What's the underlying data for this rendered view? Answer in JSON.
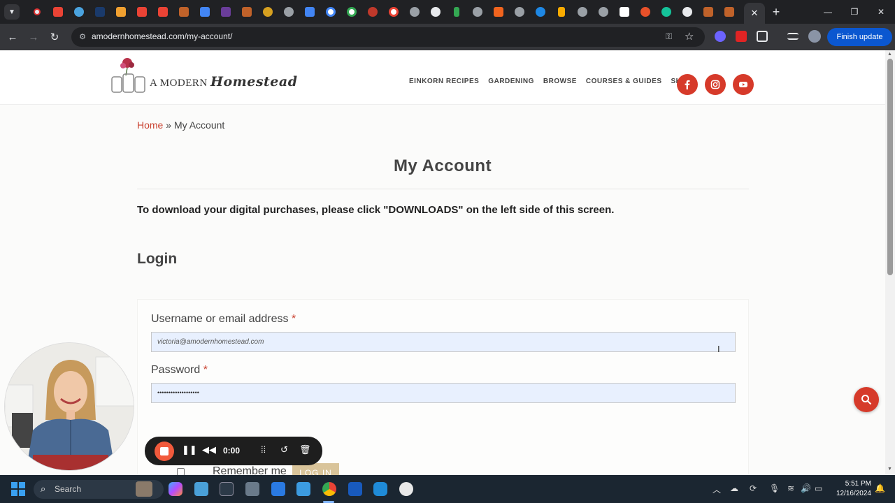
{
  "browser": {
    "url": "amodernhomestead.com/my-account/",
    "finish_update_label": "Finish update",
    "tab_close_glyph": "✕",
    "new_tab_glyph": "+"
  },
  "site": {
    "logo_prefix": "A MODERN",
    "logo_script": "Homestead",
    "nav": [
      "EINKORN RECIPES",
      "GARDENING",
      "BROWSE",
      "COURSES & GUIDES",
      "SHOP"
    ],
    "social": [
      "facebook-icon",
      "instagram-icon",
      "youtube-icon"
    ]
  },
  "breadcrumb": {
    "home": "Home",
    "separator": "»",
    "current": "My Account"
  },
  "page": {
    "title": "My Account",
    "notice": "To download your digital purchases, please click \"DOWNLOADS\" on the left side of this screen.",
    "login_heading": "Login"
  },
  "login": {
    "username_label": "Username or email address",
    "username_value": "victoria@amodernhomestead.com",
    "password_label": "Password",
    "password_value": "•••••••••••••••••••",
    "required_mark": "*",
    "remember_label": "Remember me",
    "submit_label": "LOG IN"
  },
  "recorder": {
    "time": "0:00"
  },
  "taskbar": {
    "search_label": "Search",
    "time": "5:51 PM",
    "date": "12/16/2024"
  },
  "colors": {
    "brand_red": "#d63a2a",
    "login_button": "#d9c49a",
    "autofill_blue": "#e8f0fe",
    "chrome_update": "#0b57d0"
  }
}
